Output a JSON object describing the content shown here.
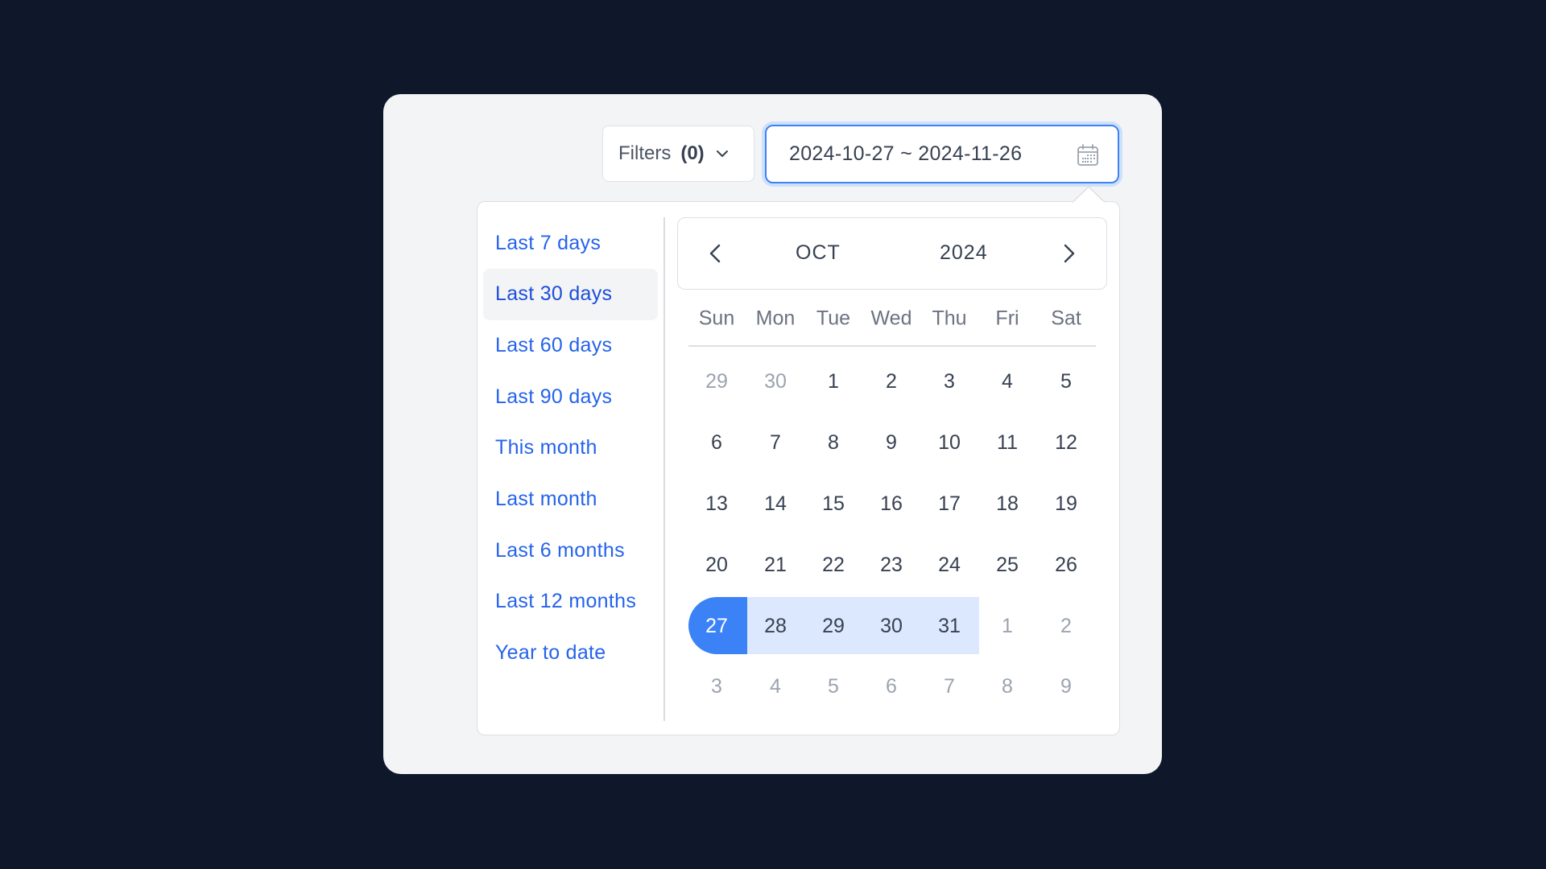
{
  "toolbar": {
    "filters_label": "Filters",
    "filters_count": "(0)",
    "date_range_value": "2024-10-27 ~ 2024-11-26"
  },
  "presets": [
    {
      "label": "Last 7 days",
      "active": false
    },
    {
      "label": "Last 30 days",
      "active": true
    },
    {
      "label": "Last 60 days",
      "active": false
    },
    {
      "label": "Last 90 days",
      "active": false
    },
    {
      "label": "This month",
      "active": false
    },
    {
      "label": "Last month",
      "active": false
    },
    {
      "label": "Last 6 months",
      "active": false
    },
    {
      "label": "Last 12 months",
      "active": false
    },
    {
      "label": "Year to date",
      "active": false
    }
  ],
  "calendar": {
    "month": "OCT",
    "year": "2024",
    "weekdays": [
      "Sun",
      "Mon",
      "Tue",
      "Wed",
      "Thu",
      "Fri",
      "Sat"
    ],
    "weeks": [
      [
        {
          "d": "29",
          "m": true
        },
        {
          "d": "30",
          "m": true
        },
        {
          "d": "1"
        },
        {
          "d": "2"
        },
        {
          "d": "3"
        },
        {
          "d": "4"
        },
        {
          "d": "5"
        }
      ],
      [
        {
          "d": "6"
        },
        {
          "d": "7"
        },
        {
          "d": "8"
        },
        {
          "d": "9"
        },
        {
          "d": "10"
        },
        {
          "d": "11"
        },
        {
          "d": "12"
        }
      ],
      [
        {
          "d": "13"
        },
        {
          "d": "14"
        },
        {
          "d": "15"
        },
        {
          "d": "16"
        },
        {
          "d": "17"
        },
        {
          "d": "18"
        },
        {
          "d": "19"
        }
      ],
      [
        {
          "d": "20"
        },
        {
          "d": "21"
        },
        {
          "d": "22"
        },
        {
          "d": "23"
        },
        {
          "d": "24"
        },
        {
          "d": "25"
        },
        {
          "d": "26"
        }
      ],
      [
        {
          "d": "27",
          "s": "start"
        },
        {
          "d": "28",
          "s": "range"
        },
        {
          "d": "29",
          "s": "range"
        },
        {
          "d": "30",
          "s": "range"
        },
        {
          "d": "31",
          "s": "range"
        },
        {
          "d": "1",
          "m": true
        },
        {
          "d": "2",
          "m": true
        }
      ],
      [
        {
          "d": "3",
          "m": true
        },
        {
          "d": "4",
          "m": true
        },
        {
          "d": "5",
          "m": true
        },
        {
          "d": "6",
          "m": true
        },
        {
          "d": "7",
          "m": true
        },
        {
          "d": "8",
          "m": true
        },
        {
          "d": "9",
          "m": true
        }
      ]
    ]
  },
  "colors": {
    "accent": "#3b82f6",
    "range": "#dbe8fd",
    "link": "#2563eb",
    "background": "#0f172a"
  }
}
